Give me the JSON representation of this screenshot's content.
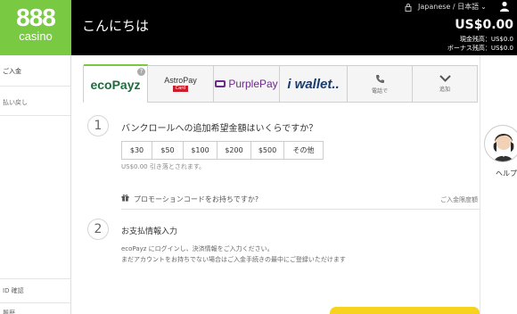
{
  "header": {
    "logo_number": "888",
    "logo_word": "casino",
    "greeting": "こんにちは",
    "language": "Japanese / 日本語",
    "balance_total": "US$0.00",
    "cash_label": "現金残高：",
    "cash_value": "US$0.0",
    "bonus_label": "ボーナス残高：",
    "bonus_value": "US$0.0"
  },
  "sidebar": {
    "items": [
      {
        "label": "ご入金"
      },
      {
        "label": "払い戻し"
      },
      {
        "label": "ID 確認"
      },
      {
        "label": "履歴"
      }
    ]
  },
  "methods": [
    {
      "name": "ecoPayz",
      "badge": "?"
    },
    {
      "name": "AstroPay",
      "sub": "Card"
    },
    {
      "name": "PurplePay"
    },
    {
      "name": "wallet.."
    },
    {
      "name": "電話で"
    },
    {
      "name": "追加"
    }
  ],
  "step1": {
    "number": "1",
    "question": "バンクロールへの追加希望金額はいくらですか？",
    "amounts": [
      "$30",
      "$50",
      "$100",
      "$200",
      "$500",
      "その他"
    ],
    "deduct_note": "US$0.00 引き落とされます。",
    "promo_text": "プロモーションコードをお持ちですか?",
    "limit_link": "ご入金限度額"
  },
  "step2": {
    "number": "2",
    "title": "お支払情報入力",
    "desc_line1": "ecoPayz にログインし、決済情報をご入力ください。",
    "desc_line2": "まだアカウントをお持ちでない場合はご入金手続きの最中にご登録いただけます"
  },
  "help": {
    "label": "ヘルプ"
  },
  "colors": {
    "brand_green": "#7ac943",
    "header_bg": "#000000",
    "cta_yellow": "#f7d21e"
  }
}
